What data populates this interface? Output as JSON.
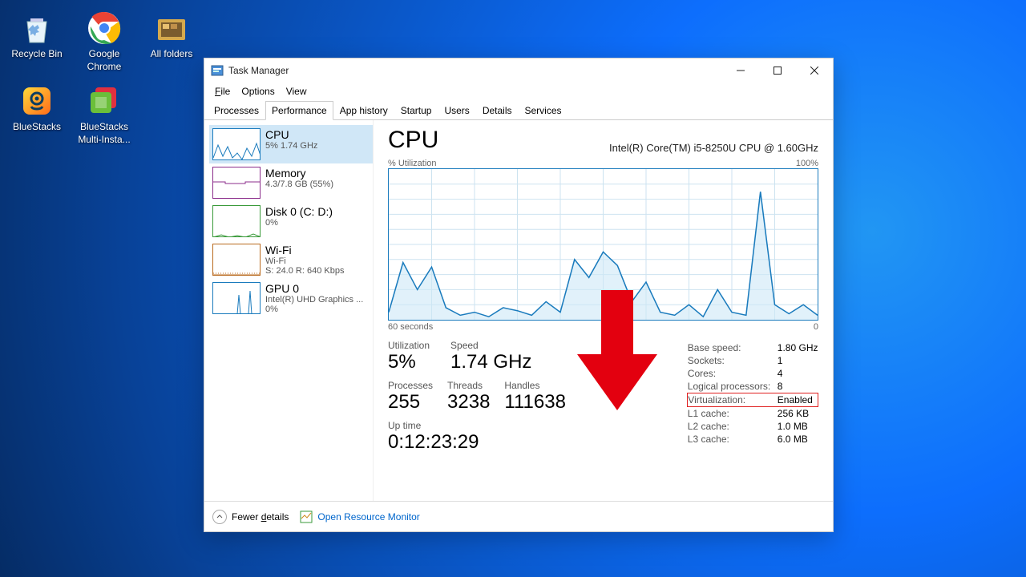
{
  "desktop": {
    "icons": [
      {
        "name": "recycle-bin",
        "label": "Recycle Bin"
      },
      {
        "name": "google-chrome",
        "label": "Google Chrome"
      },
      {
        "name": "all-folders",
        "label": "All folders"
      },
      {
        "name": "bluestacks",
        "label": "BlueStacks"
      },
      {
        "name": "bluestacks-multi",
        "label": "BlueStacks Multi-Insta..."
      }
    ]
  },
  "window": {
    "title": "Task Manager",
    "menus": [
      "File",
      "Options",
      "View"
    ],
    "tabs": [
      "Processes",
      "Performance",
      "App history",
      "Startup",
      "Users",
      "Details",
      "Services"
    ],
    "active_tab": "Performance"
  },
  "sidebar": [
    {
      "title": "CPU",
      "sub": "5%  1.74 GHz",
      "color": "#1a7bbd"
    },
    {
      "title": "Memory",
      "sub": "4.3/7.8 GB (55%)",
      "color": "#8b2d8b"
    },
    {
      "title": "Disk 0 (C: D:)",
      "sub": "0%",
      "color": "#3a9a3a"
    },
    {
      "title": "Wi-Fi",
      "sub": "Wi-Fi",
      "sub2": "S: 24.0  R: 640 Kbps",
      "color": "#b96a1e"
    },
    {
      "title": "GPU 0",
      "sub": "Intel(R) UHD Graphics ...",
      "sub2": "0%",
      "color": "#1a7bbd"
    }
  ],
  "main": {
    "heading": "CPU",
    "model": "Intel(R) Core(TM) i5-8250U CPU @ 1.60GHz",
    "chart_top_l": "% Utilization",
    "chart_top_r": "100%",
    "chart_bot_l": "60 seconds",
    "chart_bot_r": "0",
    "utilization": {
      "lbl": "Utilization",
      "val": "5%"
    },
    "speed": {
      "lbl": "Speed",
      "val": "1.74 GHz"
    },
    "processes": {
      "lbl": "Processes",
      "val": "255"
    },
    "threads": {
      "lbl": "Threads",
      "val": "3238"
    },
    "handles": {
      "lbl": "Handles",
      "val": "111638"
    },
    "uptime": {
      "lbl": "Up time",
      "val": "0:12:23:29"
    },
    "specs": [
      {
        "k": "Base speed:",
        "v": "1.80 GHz"
      },
      {
        "k": "Sockets:",
        "v": "1"
      },
      {
        "k": "Cores:",
        "v": "4"
      },
      {
        "k": "Logical processors:",
        "v": "8"
      },
      {
        "k": "Virtualization:",
        "v": "Enabled",
        "hi": true
      },
      {
        "k": "L1 cache:",
        "v": "256 KB"
      },
      {
        "k": "L2 cache:",
        "v": "1.0 MB"
      },
      {
        "k": "L3 cache:",
        "v": "6.0 MB"
      }
    ]
  },
  "footer": {
    "fewer": "Fewer details",
    "orm": "Open Resource Monitor"
  },
  "chart_data": {
    "type": "line",
    "title": "% Utilization",
    "xlabel": "60 seconds",
    "ylabel": "% Utilization",
    "xlim": [
      60,
      0
    ],
    "ylim": [
      0,
      100
    ],
    "x": [
      60,
      58,
      56,
      54,
      52,
      50,
      48,
      46,
      44,
      42,
      40,
      38,
      36,
      34,
      32,
      30,
      28,
      26,
      24,
      22,
      20,
      18,
      16,
      14,
      12,
      10,
      8,
      6,
      4,
      2,
      0
    ],
    "values": [
      5,
      38,
      20,
      35,
      8,
      3,
      5,
      2,
      8,
      6,
      3,
      12,
      5,
      40,
      28,
      45,
      36,
      12,
      25,
      5,
      3,
      10,
      2,
      20,
      5,
      3,
      85,
      10,
      4,
      10,
      3
    ]
  }
}
